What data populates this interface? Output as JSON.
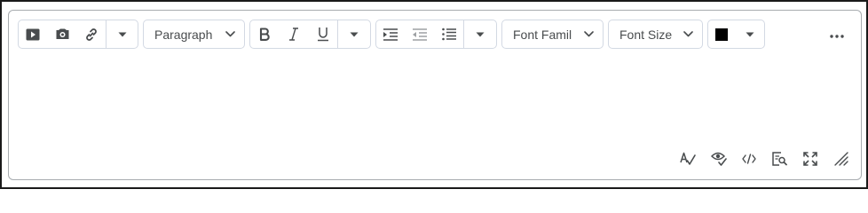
{
  "toolbar": {
    "block_format": {
      "value": "Paragraph"
    },
    "font_family": {
      "value": "Font Famil"
    },
    "font_size": {
      "value": "Font Size"
    },
    "text_color": "#000000",
    "icons": {
      "insert_media": "play-icon",
      "insert_stuff": "camera-icon",
      "insert_link": "link-icon",
      "bold": "bold-icon",
      "italic": "italic-icon",
      "underline": "underline-icon",
      "indent": "indent-icon",
      "outdent": "outdent-icon",
      "list": "bulleted-list-icon",
      "more": "more-horizontal-icon"
    }
  },
  "statusbar": {
    "icons": [
      "spellcheck-icon",
      "accessibility-checker-icon",
      "source-code-icon",
      "preview-icon",
      "fullscreen-icon",
      "resize-handle-icon"
    ]
  }
}
